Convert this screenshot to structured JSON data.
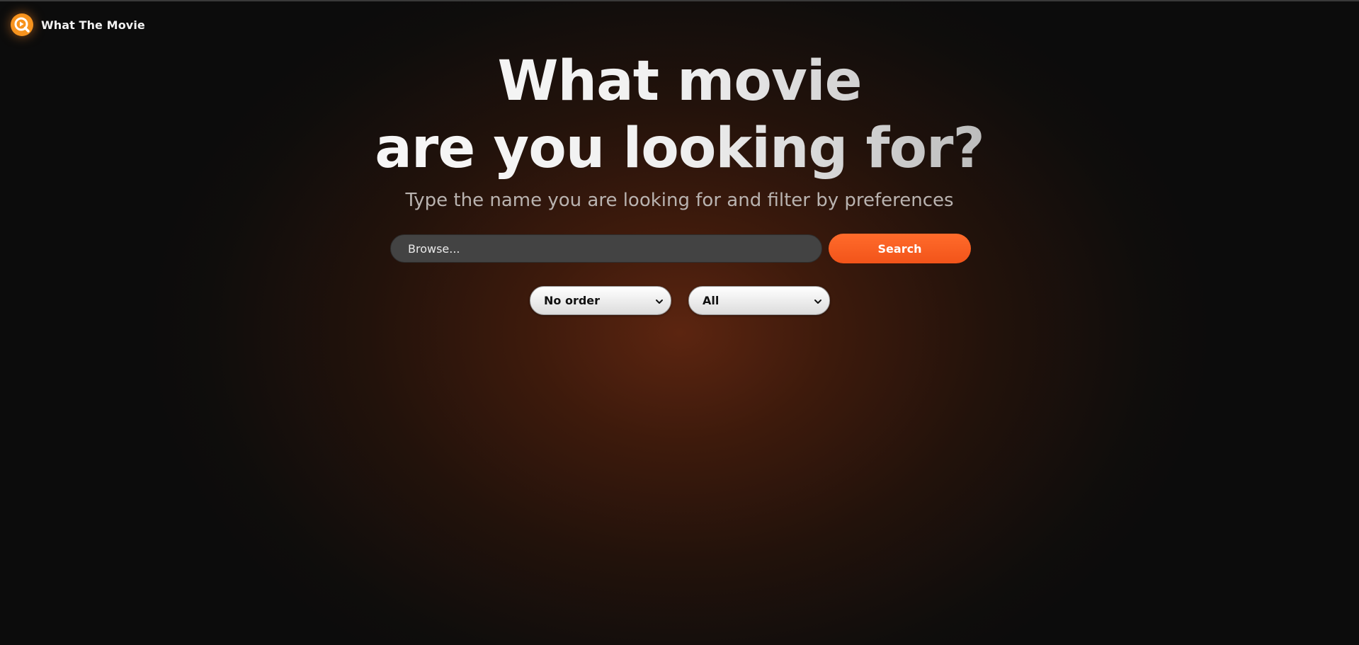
{
  "app": {
    "name": "What The Movie",
    "logo_icon": "search-play-icon"
  },
  "hero": {
    "title_line1": "What movie",
    "title_line2": "are you looking for?",
    "subtitle": "Type the name you are looking for and filter by preferences"
  },
  "search": {
    "placeholder": "Browse...",
    "button_label": "Search"
  },
  "filters": {
    "order": {
      "selected": "No order"
    },
    "genre": {
      "selected": "All"
    }
  },
  "colors": {
    "accent": "#f2541a",
    "logo": "#f7931e",
    "background": "#0c0c0c",
    "glow": "#5c2510",
    "input_bg": "#434343"
  }
}
